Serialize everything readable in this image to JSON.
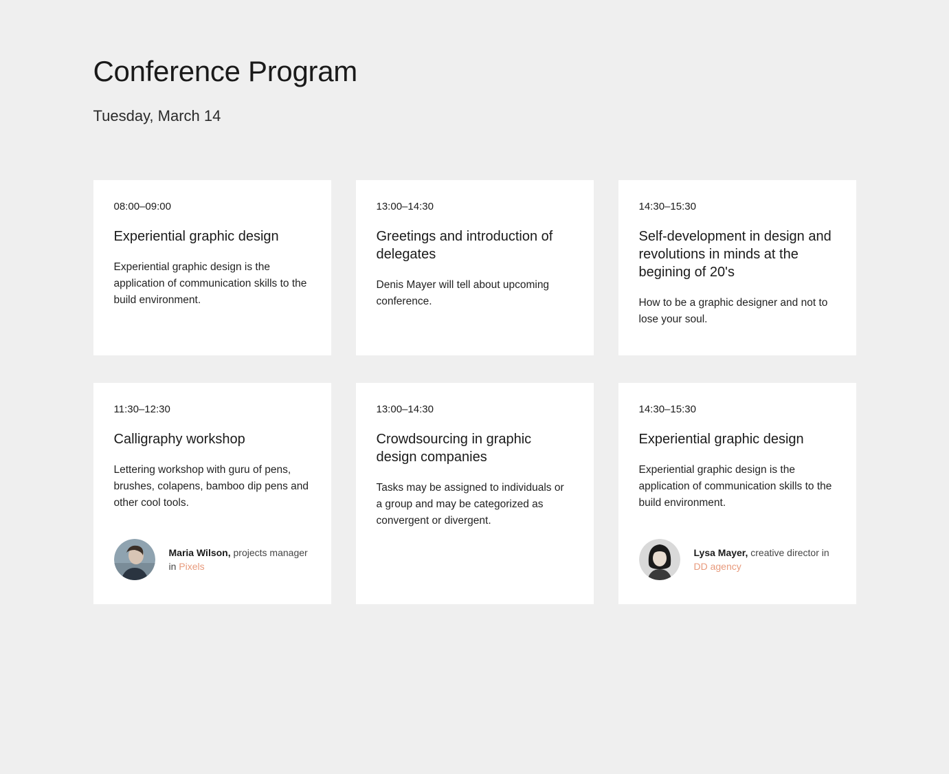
{
  "header": {
    "title": "Conference Program",
    "date": "Tuesday, March 14"
  },
  "cards": [
    {
      "time": "08:00–09:00",
      "title": "Experiential graphic design",
      "desc": "Experiential graphic design is the application of communication skills to the build environment."
    },
    {
      "time": "13:00–14:30",
      "title": "Greetings and introduction of delegates",
      "desc": "Denis Mayer will tell about upcoming conference."
    },
    {
      "time": "14:30–15:30",
      "title": "Self-development in design and revolutions in minds at the begining of 20's",
      "desc": "How to be a graphic designer and not to lose your soul."
    },
    {
      "time": "11:30–12:30",
      "title": "Calligraphy workshop",
      "desc": "Lettering workshop with guru of pens, brushes, colapens, bamboo dip pens and other cool tools.",
      "speaker": {
        "name": "Maria Wilson,",
        "role": "projects manager in ",
        "link": "Pixels"
      }
    },
    {
      "time": "13:00–14:30",
      "title": "Crowdsourcing in graphic design companies",
      "desc": "Tasks may be assigned to individuals or a group and may be categorized as convergent or divergent."
    },
    {
      "time": "14:30–15:30",
      "title": "Experiential graphic design",
      "desc": "Experiential graphic design is the application of communication skills to the build environment.",
      "speaker": {
        "name": "Lysa Mayer,",
        "role": "creative director in ",
        "link": "DD agency"
      }
    }
  ]
}
